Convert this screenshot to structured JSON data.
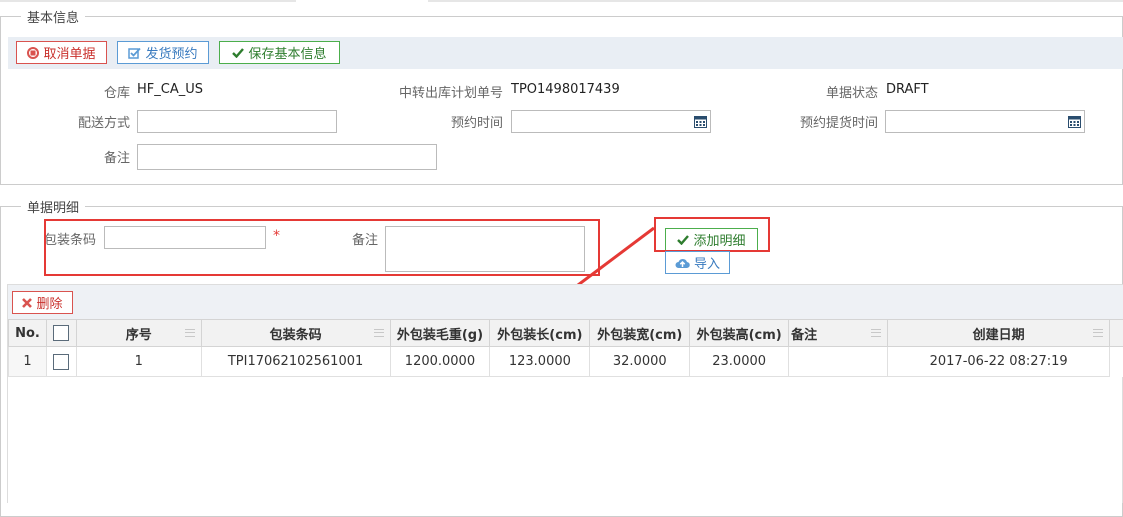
{
  "basic_section": {
    "title": "基本信息",
    "buttons": {
      "cancel": "取消单据",
      "ship_booking": "发货预约",
      "save": "保存基本信息"
    },
    "fields": {
      "warehouse_label": "仓库",
      "warehouse_value": "HF_CA_US",
      "plan_no_label": "中转出库计划单号",
      "plan_no_value": "TPO1498017439",
      "status_label": "单据状态",
      "status_value": "DRAFT",
      "delivery_label": "配送方式",
      "delivery_value": "",
      "booking_time_label": "预约时间",
      "booking_time_value": "",
      "pickup_time_label": "预约提货时间",
      "pickup_time_value": "",
      "remark_label": "备注",
      "remark_value": ""
    }
  },
  "detail_section": {
    "title": "单据明细",
    "barcode_label": "包装条码",
    "barcode_value": "",
    "required_mark": "*",
    "remark_label": "备注",
    "remark_value": "",
    "add_button": "添加明细",
    "import_button": "导入",
    "delete_button": "删除"
  },
  "grid": {
    "columns": [
      "No.",
      "",
      "序号",
      "包装条码",
      "外包装毛重(g)",
      "外包装长(cm)",
      "外包装宽(cm)",
      "外包装高(cm)",
      "备注",
      "创建日期"
    ],
    "rows": [
      {
        "no": "1",
        "seq": "1",
        "barcode": "TPI17062102561001",
        "weight": "1200.0000",
        "length": "123.0000",
        "width": "32.0000",
        "height": "23.0000",
        "remark": "",
        "created": "2017-06-22 08:27:19"
      }
    ]
  },
  "colors": {
    "accent_red": "#e53935",
    "green": "#2e7d2e",
    "blue": "#3a7bbf",
    "toolbar_bg": "#e9eef4"
  },
  "icons": [
    "ban-icon",
    "edit-check-icon",
    "check-icon",
    "calendar-icon",
    "cloud-upload-icon",
    "close-icon"
  ]
}
